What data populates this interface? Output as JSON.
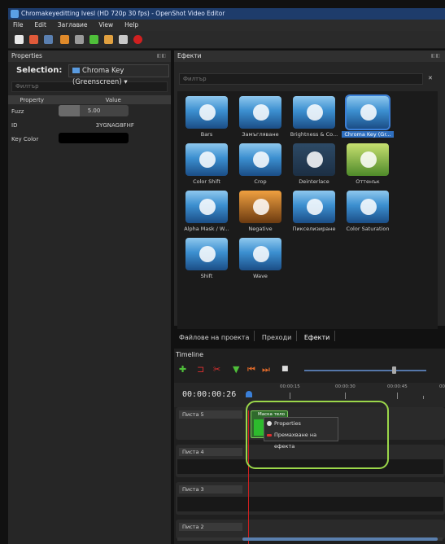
{
  "window": {
    "title": "Chromakeyeditting Ivesl (HD 720p 30 fps) - OpenShot Video Editor"
  },
  "menu": [
    "File",
    "Edit",
    "Заглавие",
    "View",
    "Help"
  ],
  "properties": {
    "header": "Properties",
    "selection_label": "Selection:",
    "selection_value": "Chroma Key (Greenscreen)",
    "filter_placeholder": "Филтър",
    "col_property": "Property",
    "col_value": "Value",
    "rows": [
      {
        "name": "Fuzz",
        "value": "5.00",
        "fill": 0.3
      },
      {
        "name": "ID",
        "value": "3YGNAG8FHF"
      },
      {
        "name": "Key Color",
        "value": ""
      }
    ]
  },
  "effects": {
    "header": "Ефекти",
    "filter_placeholder": "Филтър",
    "clear": "✕",
    "items": [
      {
        "label": "Bars",
        "style": "blue"
      },
      {
        "label": "Замъгляване",
        "style": "blue"
      },
      {
        "label": "Brightness & Co...",
        "style": "blue"
      },
      {
        "label": "Chroma Key (Gr...",
        "style": "blue",
        "selected": true
      },
      {
        "label": "Color Shift",
        "style": "blue"
      },
      {
        "label": "Crop",
        "style": "blue"
      },
      {
        "label": "Deinterlace",
        "style": "dark"
      },
      {
        "label": "Оттенък",
        "style": "green"
      },
      {
        "label": "Alpha Mask / W...",
        "style": "blue"
      },
      {
        "label": "Negative",
        "style": "warm"
      },
      {
        "label": "Пикселизиране",
        "style": "blue"
      },
      {
        "label": "Color Saturation",
        "style": "blue"
      },
      {
        "label": "Shift",
        "style": "blue"
      },
      {
        "label": "Wave",
        "style": "blue"
      }
    ]
  },
  "tabs": [
    "Файловe на проекта",
    "Преходи",
    "Ефекти"
  ],
  "timeline": {
    "title": "Timeline",
    "timecode": "00:00:00:26",
    "ruler_labels": [
      "00:00:15",
      "00:00:30",
      "00:00:45",
      "00"
    ],
    "tracks": [
      "Писта 5",
      "Писта 4",
      "Писта 3",
      "Писта 2"
    ],
    "clip_title": "Маска тело",
    "context_menu": [
      "Properties",
      "Премахване на ефекта"
    ]
  },
  "colors": {
    "accent": "#3b7fd6",
    "highlight": "#9bd74a",
    "playhead": "#d02020"
  }
}
